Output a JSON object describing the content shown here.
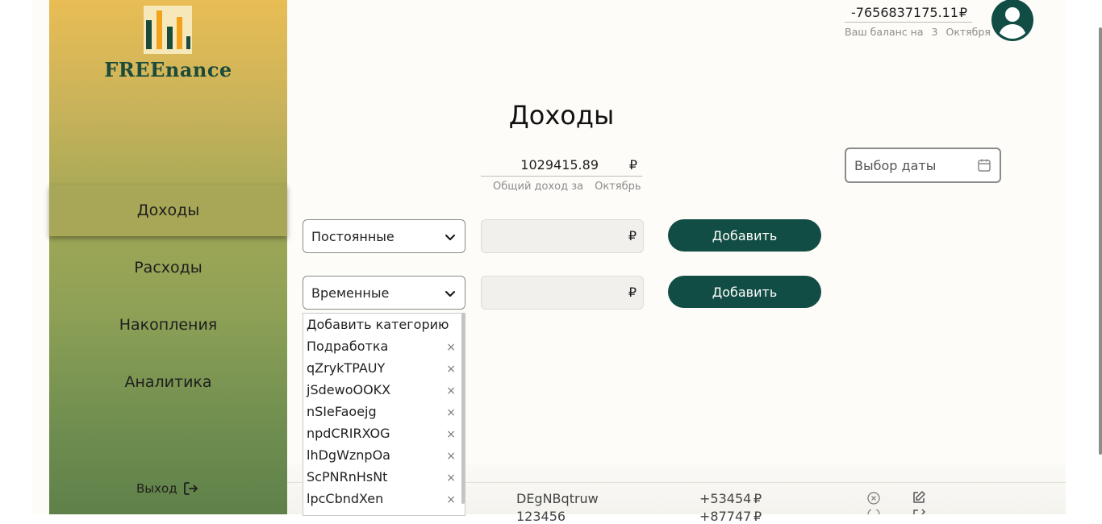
{
  "brand": {
    "name": "FREEnance"
  },
  "sidebar": {
    "items": [
      {
        "label": "Доходы",
        "active": true
      },
      {
        "label": "Расходы",
        "active": false
      },
      {
        "label": "Накопления",
        "active": false
      },
      {
        "label": "Аналитика",
        "active": false
      }
    ],
    "logout_label": "Выход"
  },
  "header": {
    "balance_value": "-7656837175.11",
    "currency": "₽",
    "balance_caption": "Ваш баланс на",
    "balance_day": "3",
    "balance_month": "Октября"
  },
  "main": {
    "title": "Доходы",
    "total_value": "1029415.89",
    "total_currency": "₽",
    "total_caption": "Общий доход за",
    "total_month": "Октябрь",
    "date_placeholder": "Выбор даты",
    "forms": [
      {
        "category": "Постоянные",
        "currency": "₽",
        "button": "Добавить"
      },
      {
        "category": "Временные",
        "currency": "₽",
        "button": "Добавить"
      }
    ]
  },
  "dropdown": {
    "add_label": "Добавить категорию",
    "items": [
      "Подработка",
      "qZrykTPAUY",
      "jSdewoOOKX",
      "nSIeFaoejg",
      "npdCRIRXOG",
      "lhDgWznpOa",
      "ScPNRnHsNt",
      "lpcCbndXen"
    ],
    "remove_symbol": "×"
  },
  "table": {
    "rows": [
      {
        "name": "DEgNBqtruw",
        "amount": "+53454",
        "currency": "₽"
      },
      {
        "name": "123456",
        "amount": "+87747",
        "currency": "₽"
      }
    ]
  },
  "colors": {
    "accent": "#114d44",
    "sidebar_top": "#e9bd55",
    "sidebar_bottom": "#5f8149",
    "active_item": "#a7a757"
  }
}
